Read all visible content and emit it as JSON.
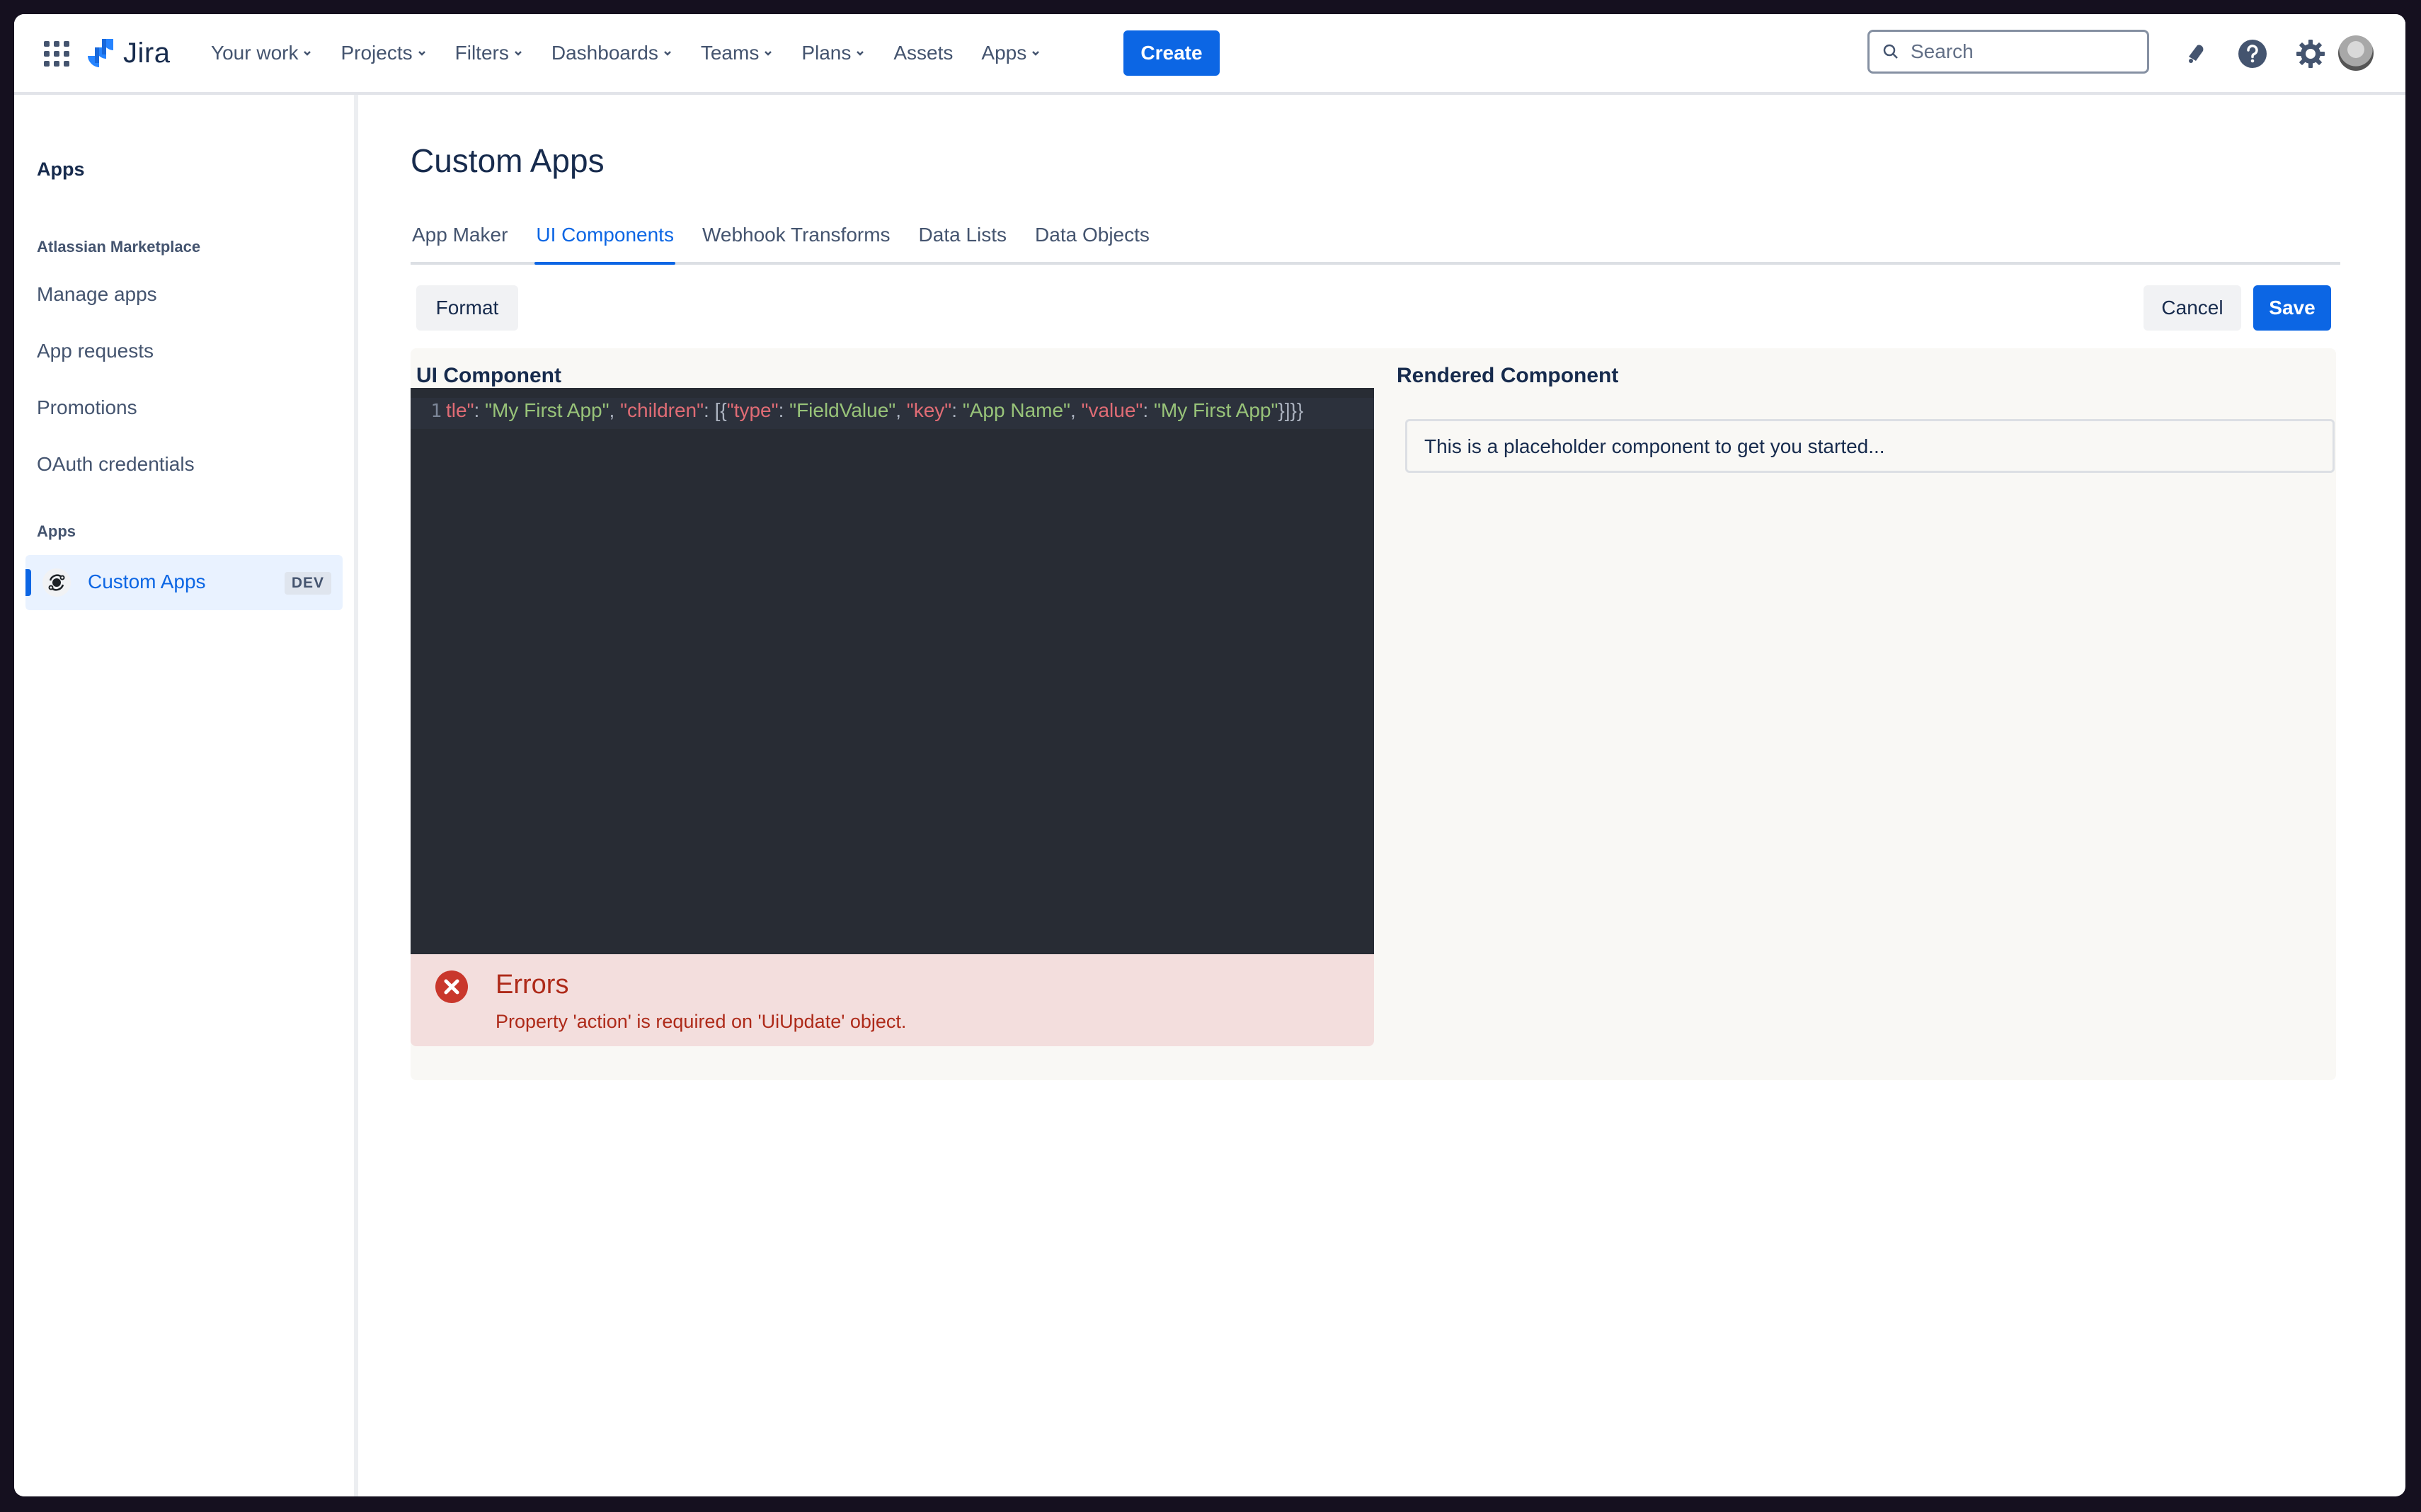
{
  "header": {
    "product_name": "Jira",
    "nav": [
      {
        "label": "Your work",
        "has_dropdown": true
      },
      {
        "label": "Projects",
        "has_dropdown": true
      },
      {
        "label": "Filters",
        "has_dropdown": true
      },
      {
        "label": "Dashboards",
        "has_dropdown": true
      },
      {
        "label": "Teams",
        "has_dropdown": true
      },
      {
        "label": "Plans",
        "has_dropdown": true
      },
      {
        "label": "Assets",
        "has_dropdown": false
      },
      {
        "label": "Apps",
        "has_dropdown": true
      }
    ],
    "create_label": "Create",
    "search_placeholder": "Search",
    "icons": [
      "notifications-icon",
      "help-icon",
      "settings-icon",
      "avatar"
    ]
  },
  "sidebar": {
    "title": "Apps",
    "sections": [
      {
        "heading": "Atlassian Marketplace",
        "items": [
          "Manage apps",
          "App requests",
          "Promotions",
          "OAuth credentials"
        ]
      },
      {
        "heading": "Apps",
        "items": []
      }
    ],
    "active_item": {
      "label": "Custom Apps",
      "badge": "DEV",
      "icon": "custom-apps-icon"
    }
  },
  "main": {
    "title": "Custom Apps",
    "tabs": [
      {
        "label": "App Maker",
        "active": false
      },
      {
        "label": "UI Components",
        "active": true
      },
      {
        "label": "Webhook Transforms",
        "active": false
      },
      {
        "label": "Data Lists",
        "active": false
      },
      {
        "label": "Data Objects",
        "active": false
      }
    ],
    "buttons": {
      "format": "Format",
      "cancel": "Cancel",
      "save": "Save"
    },
    "editor": {
      "label": "UI Component",
      "line_number": "1",
      "tokens": [
        {
          "t": "k",
          "v": "tle\""
        },
        {
          "t": "p",
          "v": ": "
        },
        {
          "t": "s",
          "v": "\"My First App\""
        },
        {
          "t": "p",
          "v": ", "
        },
        {
          "t": "k",
          "v": "\"children\""
        },
        {
          "t": "p",
          "v": ": [{"
        },
        {
          "t": "k",
          "v": "\"type\""
        },
        {
          "t": "p",
          "v": ": "
        },
        {
          "t": "s",
          "v": "\"FieldValue\""
        },
        {
          "t": "p",
          "v": ", "
        },
        {
          "t": "k",
          "v": "\"key\""
        },
        {
          "t": "p",
          "v": ": "
        },
        {
          "t": "s",
          "v": "\"App Name\""
        },
        {
          "t": "p",
          "v": ", "
        },
        {
          "t": "k",
          "v": "\"value\""
        },
        {
          "t": "p",
          "v": ": "
        },
        {
          "t": "s",
          "v": "\"My First App\""
        },
        {
          "t": "p",
          "v": "}]}}"
        }
      ]
    },
    "errors": {
      "title": "Errors",
      "message": "Property 'action' is required on 'UiUpdate' object."
    },
    "rendered": {
      "label": "Rendered Component",
      "text": "This is a placeholder component to get you started..."
    }
  },
  "colors": {
    "brand": "#0c66e4",
    "text": "#172b4d",
    "subtle_text": "#44546f",
    "editor_bg": "#282c34",
    "error_bg": "#f3dedd",
    "error_text": "#ae2a19",
    "json_key": "#e06c75",
    "json_string": "#98c379"
  }
}
